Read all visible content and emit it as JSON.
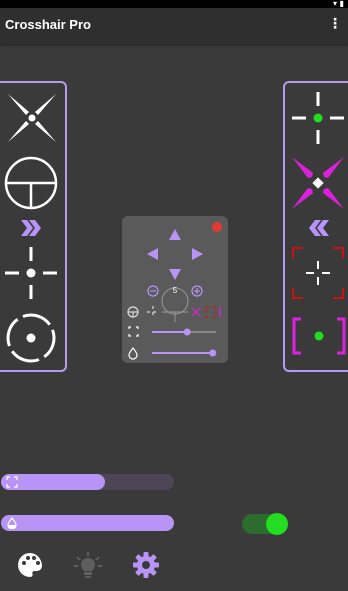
{
  "status_bar": {
    "icons_text": "▾ ▮"
  },
  "app": {
    "title": "Crosshair Pro",
    "menu_icon": "more-vert-icon"
  },
  "left_panel": {
    "items": [
      "crosshair-x-icon",
      "crosshair-scope-icon",
      "chevron-right-double-icon",
      "crosshair-plus-gap-icon",
      "crosshair-circle-dot-icon"
    ]
  },
  "right_panel": {
    "items": [
      "crosshair-plus-green-dot-icon",
      "crosshair-magenta-x-icon",
      "chevron-left-double-icon",
      "crosshair-red-brackets-icon",
      "crosshair-magenta-brackets-green-dot-icon"
    ]
  },
  "control_panel": {
    "size_value": "5",
    "record_icon": "record-icon",
    "size_slider_level": 0.55,
    "opacity_slider_level": 0.95
  },
  "bottom": {
    "size_slider_level": 0.6,
    "opacity_slider_level": 1.0,
    "toggle_on": true,
    "nav": [
      "palette-icon",
      "lightbulb-icon",
      "gear-icon"
    ]
  },
  "colors": {
    "accent": "#b794f6",
    "green": "#22dd22",
    "magenta": "#e020e0",
    "red": "#cc1111"
  }
}
